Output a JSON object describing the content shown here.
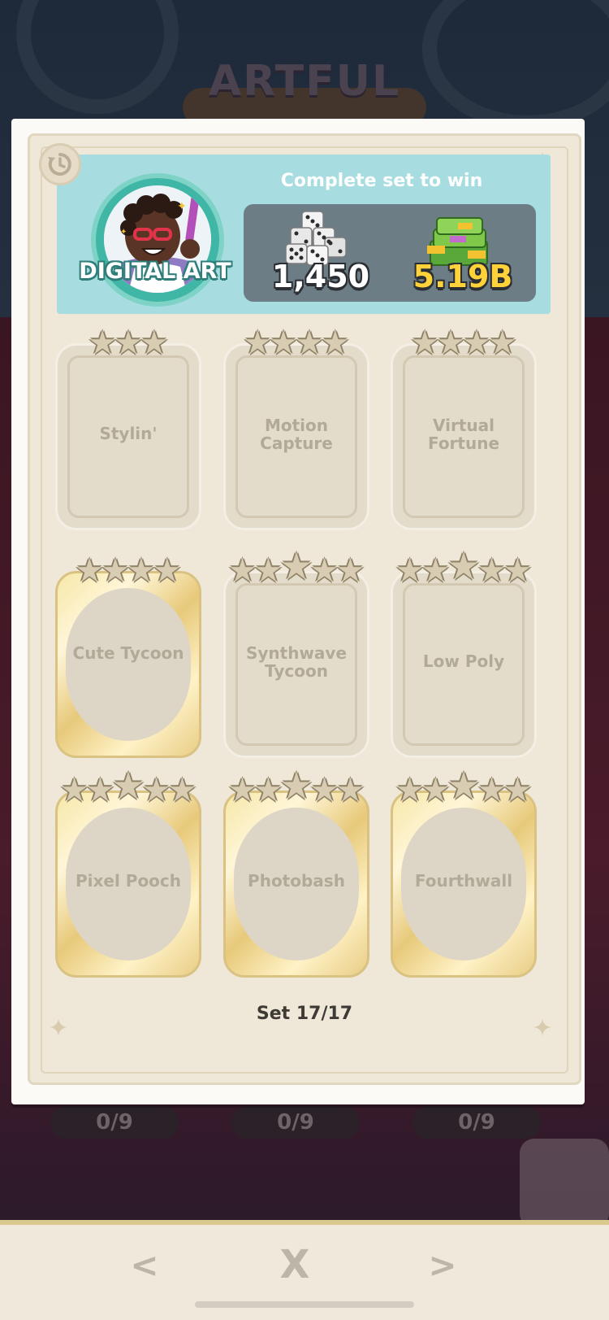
{
  "background": {
    "album_title": "ARTFUL",
    "set_progress_pills": [
      "0/9",
      "0/9",
      "0/9"
    ]
  },
  "set": {
    "name": "DIGITAL ART",
    "prize_title": "Complete set to win",
    "dice_reward": "1,450",
    "cash_reward": "5.19B",
    "counter": "Set 17/17"
  },
  "stickers": [
    {
      "name": "Stylin'",
      "stars": 3,
      "gold": false
    },
    {
      "name": "Motion Capture",
      "stars": 4,
      "gold": false
    },
    {
      "name": "Virtual Fortune",
      "stars": 4,
      "gold": false
    },
    {
      "name": "Cute Tycoon",
      "stars": 4,
      "gold": true
    },
    {
      "name": "Synthwave Tycoon",
      "stars": 5,
      "gold": false
    },
    {
      "name": "Low Poly",
      "stars": 5,
      "gold": false
    },
    {
      "name": "Pixel Pooch",
      "stars": 5,
      "gold": true
    },
    {
      "name": "Photobash",
      "stars": 5,
      "gold": true
    },
    {
      "name": "Fourthwall",
      "stars": 5,
      "gold": true
    }
  ],
  "nav": {
    "prev": "<",
    "close": "X",
    "next": ">"
  },
  "icons": {
    "history": "history-icon",
    "dice": "dice-icon",
    "cash": "cash-stack-icon",
    "star": "star-icon"
  },
  "colors": {
    "header_bg": "#a7dde0",
    "cash_text": "#ffd23a",
    "card_bg": "#efe8d9"
  }
}
